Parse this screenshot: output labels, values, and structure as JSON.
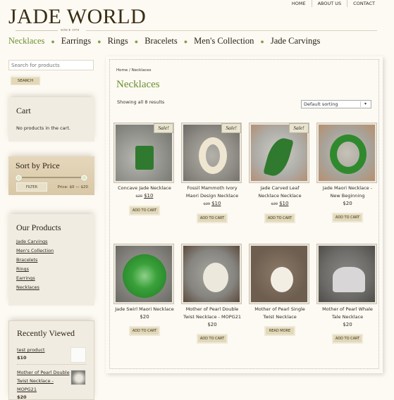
{
  "brand": {
    "name": "JADE WORLD",
    "tagline": "SINCE 1978"
  },
  "top_links": [
    "HOME",
    "ABOUT US",
    "CONTACT"
  ],
  "nav": [
    {
      "label": "Necklaces",
      "active": true
    },
    {
      "label": "Earrings",
      "active": false
    },
    {
      "label": "Rings",
      "active": false
    },
    {
      "label": "Bracelets",
      "active": false
    },
    {
      "label": "Men's Collection",
      "active": false
    },
    {
      "label": "Jade Carvings",
      "active": false
    }
  ],
  "sidebar": {
    "search": {
      "placeholder": "Search for products",
      "button": "SEARCH"
    },
    "cart": {
      "title": "Cart",
      "empty": "No products in the cart."
    },
    "price_filter": {
      "title": "Sort by Price",
      "button": "FILTER",
      "label": "Price: $0 — $20",
      "min_fraction": 0,
      "max_fraction": 1
    },
    "our_products": {
      "title": "Our Products",
      "items": [
        "Jade Carvings",
        "Men's Collection",
        "Bracelets",
        "Rings",
        "Earrings",
        "Necklaces"
      ]
    },
    "recently_viewed": {
      "title": "Recently Viewed",
      "items": [
        {
          "name": "test product",
          "price": "$10"
        },
        {
          "name": "Mother of Pearl Double Twist Necklace - MOPG21",
          "price": "$20"
        }
      ]
    }
  },
  "main": {
    "breadcrumb": "Home / Necklaces",
    "title": "Necklaces",
    "result_count": "Showing all 8 results",
    "sorting": "Default sorting",
    "products": [
      {
        "name": "Concave Jade Necklace",
        "old_price": "$20",
        "price": "$10",
        "sale": "Sale!",
        "button": "ADD TO CART"
      },
      {
        "name": "Fossil Mammoth Ivory Maori Design Necklace",
        "old_price": "$20",
        "price": "$10",
        "sale": "Sale!",
        "button": "ADD TO CART"
      },
      {
        "name": "Jade Carved Leaf Necklace Necklace",
        "old_price": "$20",
        "price": "$10",
        "sale": "Sale!",
        "button": "ADD TO CART"
      },
      {
        "name": "Jade Maori Necklace - New Beginning",
        "old_price": null,
        "price": "$20",
        "sale": null,
        "button": "ADD TO CART"
      },
      {
        "name": "Jade Swirl Maori Necklace",
        "old_price": null,
        "price": "$20",
        "sale": null,
        "button": "ADD TO CART"
      },
      {
        "name": "Mother of Pearl Double Twist Necklace - MOPG21",
        "old_price": null,
        "price": "$20",
        "sale": null,
        "button": "ADD TO CART"
      },
      {
        "name": "Mother of Pearl Single Twist Necklace",
        "old_price": null,
        "price": null,
        "sale": null,
        "button": "READ MORE"
      },
      {
        "name": "Mother of Pearl Whale Tale Necklace",
        "old_price": null,
        "price": "$20",
        "sale": null,
        "button": "ADD TO CART"
      }
    ]
  },
  "colors": {
    "accent_green": "#6b8f2e",
    "button_beige": "#e2d9b9",
    "background": "#fdfaf3"
  }
}
